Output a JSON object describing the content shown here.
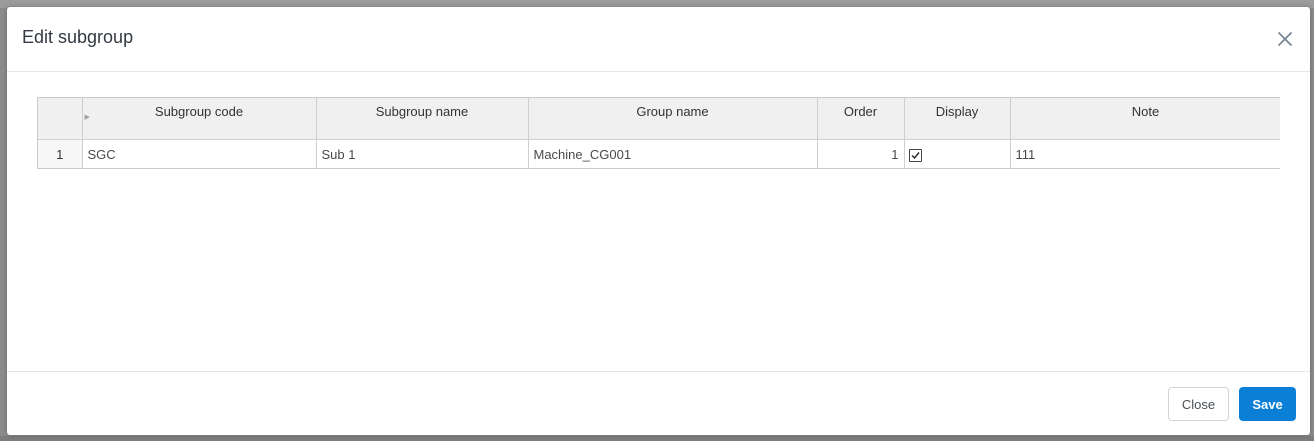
{
  "modal": {
    "title": "Edit subgroup",
    "close_icon": "close-icon"
  },
  "grid": {
    "columns": [
      "Subgroup code",
      "Subgroup name",
      "Group name",
      "Order",
      "Display",
      "Note"
    ],
    "rows": [
      {
        "row_number": "1",
        "subgroup_code": "SGC",
        "subgroup_name": "Sub 1",
        "group_name": "Machine_CG001",
        "order": "1",
        "display_checked": true,
        "note": "111"
      }
    ]
  },
  "footer": {
    "close_label": "Close",
    "save_label": "Save"
  },
  "colors": {
    "primary": "#0b7fd6",
    "header_bg": "#f0f0f0"
  }
}
